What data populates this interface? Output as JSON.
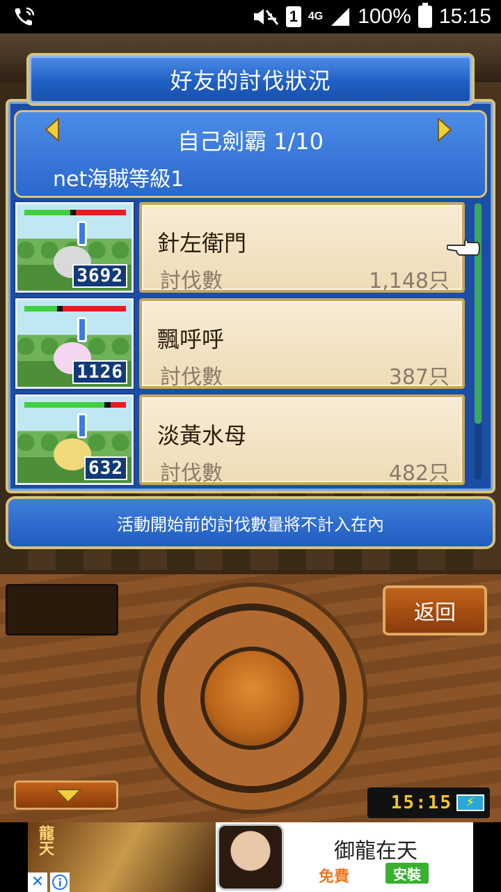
{
  "status_bar": {
    "sim_slot": "1",
    "network": "4G",
    "battery": "100%",
    "time": "15:15"
  },
  "dialog": {
    "title": "好友的討伐狀況",
    "ranking": "自己劍霸 1/10",
    "subtitle": "net海賊等級1",
    "notice": "活動開始前的討伐數量將不計入在內"
  },
  "friends": [
    {
      "name": "針左衛門",
      "label": "討伐數",
      "count": "1,148只",
      "score": "3692",
      "hp": 0.45,
      "monster_color": "#d9d9d9"
    },
    {
      "name": "飄呼呼",
      "label": "討伐數",
      "count": "387只",
      "score": "1126",
      "hp": 0.32,
      "monster_color": "#f4d6f0"
    },
    {
      "name": "淡黃水母",
      "label": "討伐數",
      "count": "482只",
      "score": "632",
      "hp": 0.79,
      "monster_color": "#f1d97a"
    }
  ],
  "controller": {
    "back_label": "返回",
    "clock": "15:15"
  },
  "ad": {
    "brand": "龍天",
    "title": "御龍在天",
    "free_label": "免費",
    "install_label": "安裝",
    "close_glyph": "✕"
  },
  "colors": {
    "panel_blue": "#1b4fa5",
    "gold_border": "#d9c27a",
    "card_bg": "#f7ecd5",
    "hp_green": "#3fcf3f",
    "hp_red": "#e01f1f"
  }
}
